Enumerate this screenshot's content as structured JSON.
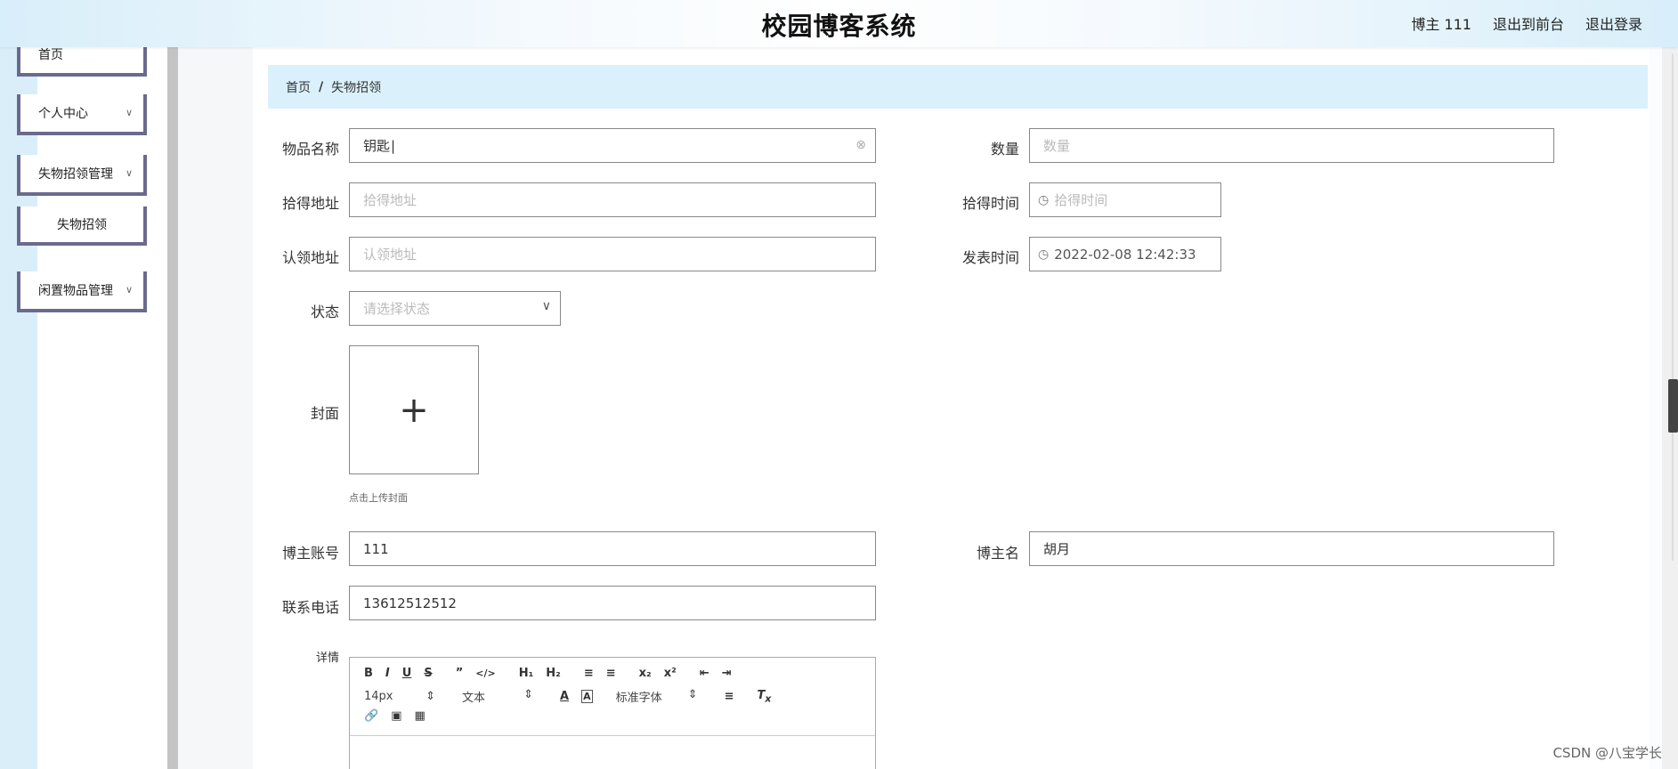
{
  "header": {
    "title": "校园博客系统",
    "user": "博主 111",
    "to_front": "退出到前台",
    "logout": "退出登录"
  },
  "sidebar": {
    "items": [
      {
        "label": "首页"
      },
      {
        "label": "个人中心"
      },
      {
        "label": "失物招领管理"
      },
      {
        "label": "失物招领"
      },
      {
        "label": "闲置物品管理"
      }
    ]
  },
  "breadcrumb": {
    "home": "首页",
    "sep": "/",
    "current": "失物招领"
  },
  "form": {
    "item_name": {
      "label": "物品名称",
      "value": "钥匙"
    },
    "quantity": {
      "label": "数量",
      "placeholder": "数量"
    },
    "found_address": {
      "label": "拾得地址",
      "placeholder": "拾得地址"
    },
    "found_time": {
      "label": "拾得时间",
      "placeholder": "拾得时间"
    },
    "claim_address": {
      "label": "认领地址",
      "placeholder": "认领地址"
    },
    "publish_time": {
      "label": "发表时间",
      "value": "2022-02-08 12:42:33"
    },
    "status": {
      "label": "状态",
      "placeholder": "请选择状态"
    },
    "cover": {
      "label": "封面",
      "hint": "点击上传封面"
    },
    "blogger_account": {
      "label": "博主账号",
      "value": "111"
    },
    "blogger_name": {
      "label": "博主名",
      "value": "胡月"
    },
    "phone": {
      "label": "联系电话",
      "value": "13612512512"
    },
    "details": {
      "label": "详情"
    }
  },
  "editor": {
    "font_size": "14px",
    "text_type": "文本",
    "font_family": "标准字体"
  },
  "watermark": "CSDN @八宝学长"
}
